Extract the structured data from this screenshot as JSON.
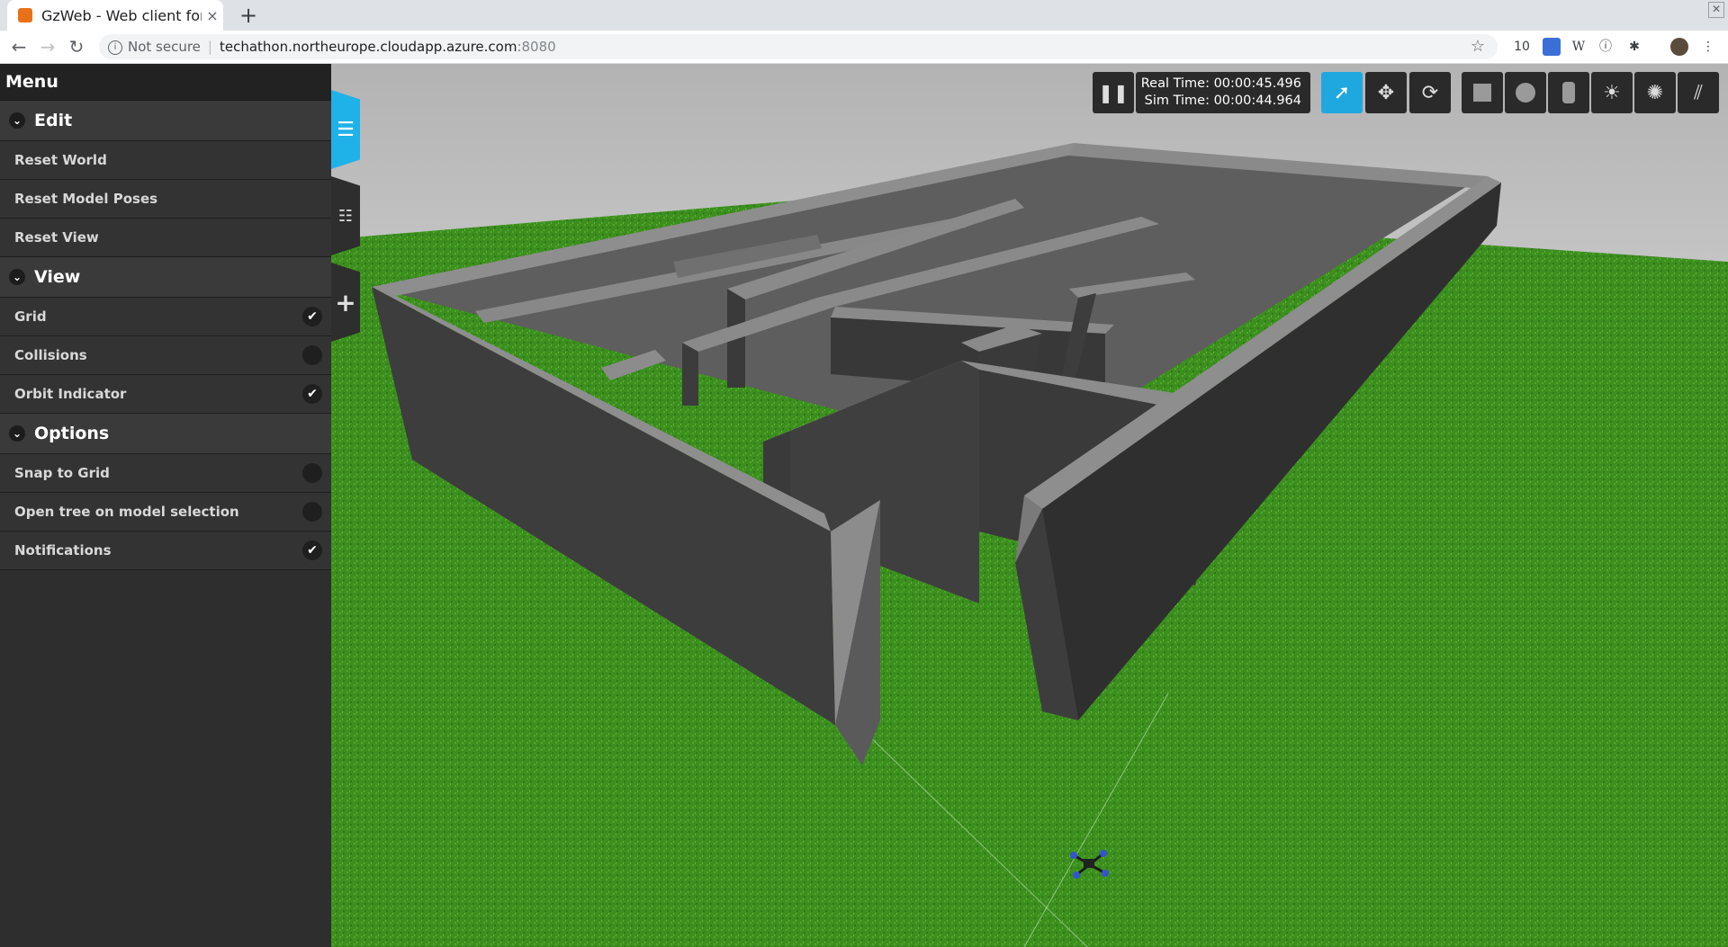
{
  "browser": {
    "tab_title": "GzWeb - Web client for",
    "tab_close": "×",
    "new_tab": "+",
    "omnibox": {
      "security": "Not secure",
      "host": "techathon.northeurope.cloudapp.azure.com",
      "port": ":8080"
    },
    "extensions": [
      "10",
      "W"
    ]
  },
  "sidebar": {
    "title": "Menu",
    "sections": [
      {
        "label": "Edit",
        "items": [
          {
            "label": "Reset World"
          },
          {
            "label": "Reset Model Poses"
          },
          {
            "label": "Reset View"
          }
        ]
      },
      {
        "label": "View",
        "items": [
          {
            "label": "Grid",
            "checked": true
          },
          {
            "label": "Collisions",
            "checked": false
          },
          {
            "label": "Orbit Indicator",
            "checked": true
          }
        ]
      },
      {
        "label": "Options",
        "items": [
          {
            "label": "Snap to Grid",
            "checked": false
          },
          {
            "label": "Open tree on model selection",
            "checked": false
          },
          {
            "label": "Notifications",
            "checked": true
          }
        ]
      }
    ]
  },
  "sim": {
    "real_time": "Real Time: 00:00:45.496",
    "sim_time": "Sim Time: 00:00:44.964"
  },
  "icons": {
    "pause": "pause-icon",
    "select": "select-mode-icon",
    "translate": "translate-mode-icon",
    "rotate": "rotate-mode-icon",
    "box": "box-icon",
    "sphere": "sphere-icon",
    "cylinder": "cylinder-icon",
    "pointlight": "point-light-icon",
    "spotlight": "spot-light-icon",
    "dirlight": "directional-light-icon"
  },
  "colors": {
    "accent": "#1fa8e0",
    "ground": "#3a8f1e",
    "sky": "#b9b9b9",
    "wall_top": "#8a8a8a",
    "wall_side": "#3d3d3d"
  }
}
